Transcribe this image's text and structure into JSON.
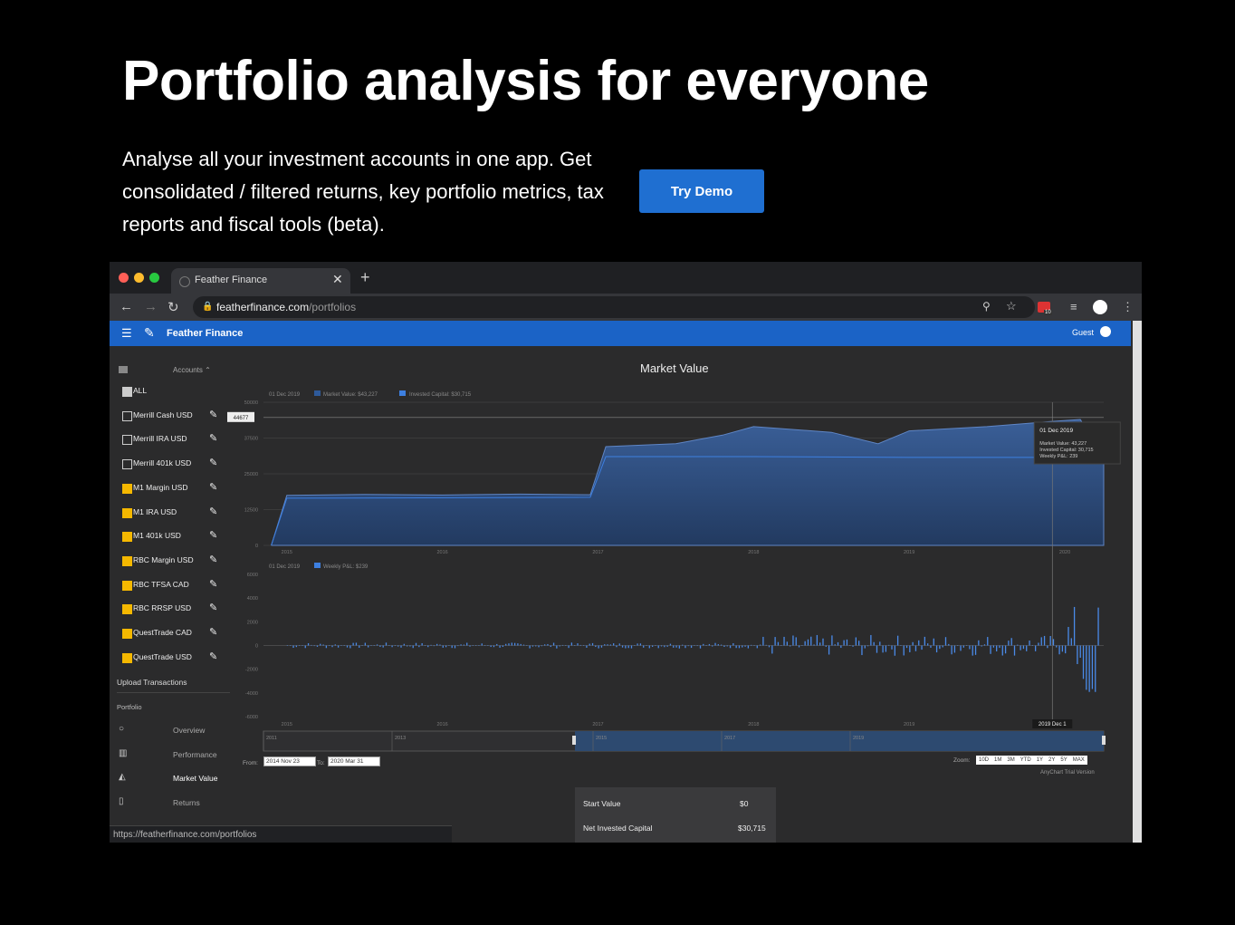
{
  "hero": {
    "title": "Portfolio analysis for everyone",
    "description": "Analyse all your investment accounts in one app. Get consolidated / filtered returns, key portfolio metrics, tax reports and fiscal tools (beta).",
    "cta_label": "Try Demo"
  },
  "browser": {
    "tab_title": "Feather Finance",
    "url_host": "featherfinance.com",
    "url_path": "/portfolios",
    "status_url": "https://featherfinance.com/portfolios",
    "ext_badge": "10"
  },
  "app": {
    "brand": "Feather Finance",
    "user": "Guest",
    "accent": "#1b63c6"
  },
  "sidebar": {
    "accounts_header": "Accounts",
    "accounts": [
      {
        "label": "ALL",
        "checked": "all"
      },
      {
        "label": "Merrill Cash USD",
        "checked": "off"
      },
      {
        "label": "Merrill IRA USD",
        "checked": "off"
      },
      {
        "label": "Merrill 401k USD",
        "checked": "off"
      },
      {
        "label": "M1 Margin USD",
        "checked": "on"
      },
      {
        "label": "M1 IRA USD",
        "checked": "on"
      },
      {
        "label": "M1 401k USD",
        "checked": "on"
      },
      {
        "label": "RBC Margin USD",
        "checked": "on"
      },
      {
        "label": "RBC TFSA CAD",
        "checked": "on"
      },
      {
        "label": "RBC RRSP USD",
        "checked": "on"
      },
      {
        "label": "QuestTrade CAD",
        "checked": "on"
      },
      {
        "label": "QuestTrade USD",
        "checked": "on"
      }
    ],
    "upload": "Upload Transactions",
    "portfolio_header": "Portfolio",
    "nav": [
      {
        "label": "Overview",
        "icon": "circle-icon"
      },
      {
        "label": "Performance",
        "icon": "bar-chart-icon"
      },
      {
        "label": "Market Value",
        "icon": "area-chart-icon",
        "active": true
      },
      {
        "label": "Returns",
        "icon": "column-chart-icon"
      }
    ]
  },
  "chart": {
    "title": "Market Value",
    "legend_top_date": "01 Dec 2019",
    "legend_market_value": "Market Value: $43,227",
    "legend_invested": "Invested Capital: $30,715",
    "legend_bottom_date": "01 Dec 2019",
    "legend_weekly": "Weekly P&L: $239",
    "crosshair_value": "44677",
    "tooltip_date": "01 Dec 2019",
    "tooltip_mv": "Market Value: 43,227",
    "tooltip_ic": "Invested Capital: 30,715",
    "tooltip_pl": "Weekly P&L: 239",
    "bottom_date_label": "2019 Dec 1",
    "from_label": "From:",
    "from_value": "2014 Nov 23",
    "to_label": "To:",
    "to_value": "2020 Mar 31",
    "zoom_label": "Zoom:",
    "zoom_options": [
      "10D",
      "1M",
      "3M",
      "YTD",
      "1Y",
      "2Y",
      "5Y",
      "MAX"
    ],
    "credit": "AnyChart Trial Version"
  },
  "chart_data": [
    {
      "type": "area",
      "title": "Market Value",
      "x_ticks": [
        "2015",
        "2016",
        "2017",
        "2018",
        "2019",
        "2020"
      ],
      "y_ticks": [
        0,
        12500,
        25000,
        37500,
        50000
      ],
      "ylim": [
        0,
        50000
      ],
      "series": [
        {
          "name": "Market Value",
          "color": "#2e5a9a",
          "x": [
            2014.9,
            2015.0,
            2015.5,
            2016.0,
            2016.5,
            2016.95,
            2017.05,
            2017.5,
            2017.8,
            2018.0,
            2018.5,
            2018.8,
            2019.0,
            2019.5,
            2019.9,
            2020.1,
            2020.25
          ],
          "values": [
            0,
            17500,
            17800,
            17600,
            17900,
            17700,
            34500,
            35500,
            38500,
            41500,
            39500,
            35500,
            40000,
            41500,
            43227,
            44000,
            30000
          ]
        },
        {
          "name": "Invested Capital",
          "color": "#3d7fe0",
          "x": [
            2014.9,
            2015.0,
            2016.95,
            2017.05,
            2018.0,
            2019.0,
            2020.25
          ],
          "values": [
            0,
            16500,
            16800,
            31000,
            31000,
            30715,
            30715
          ]
        }
      ]
    },
    {
      "type": "bar",
      "title": "Weekly P&L",
      "x_ticks": [
        "2015",
        "2016",
        "2017",
        "2018",
        "2019",
        "2020"
      ],
      "y_ticks": [
        -6000,
        -4000,
        -2000,
        0,
        2000,
        4000,
        6000
      ],
      "ylim": [
        -6000,
        6000
      ],
      "series": [
        {
          "name": "Weekly P&L",
          "color": "#3d7fe0"
        }
      ]
    }
  ]
}
